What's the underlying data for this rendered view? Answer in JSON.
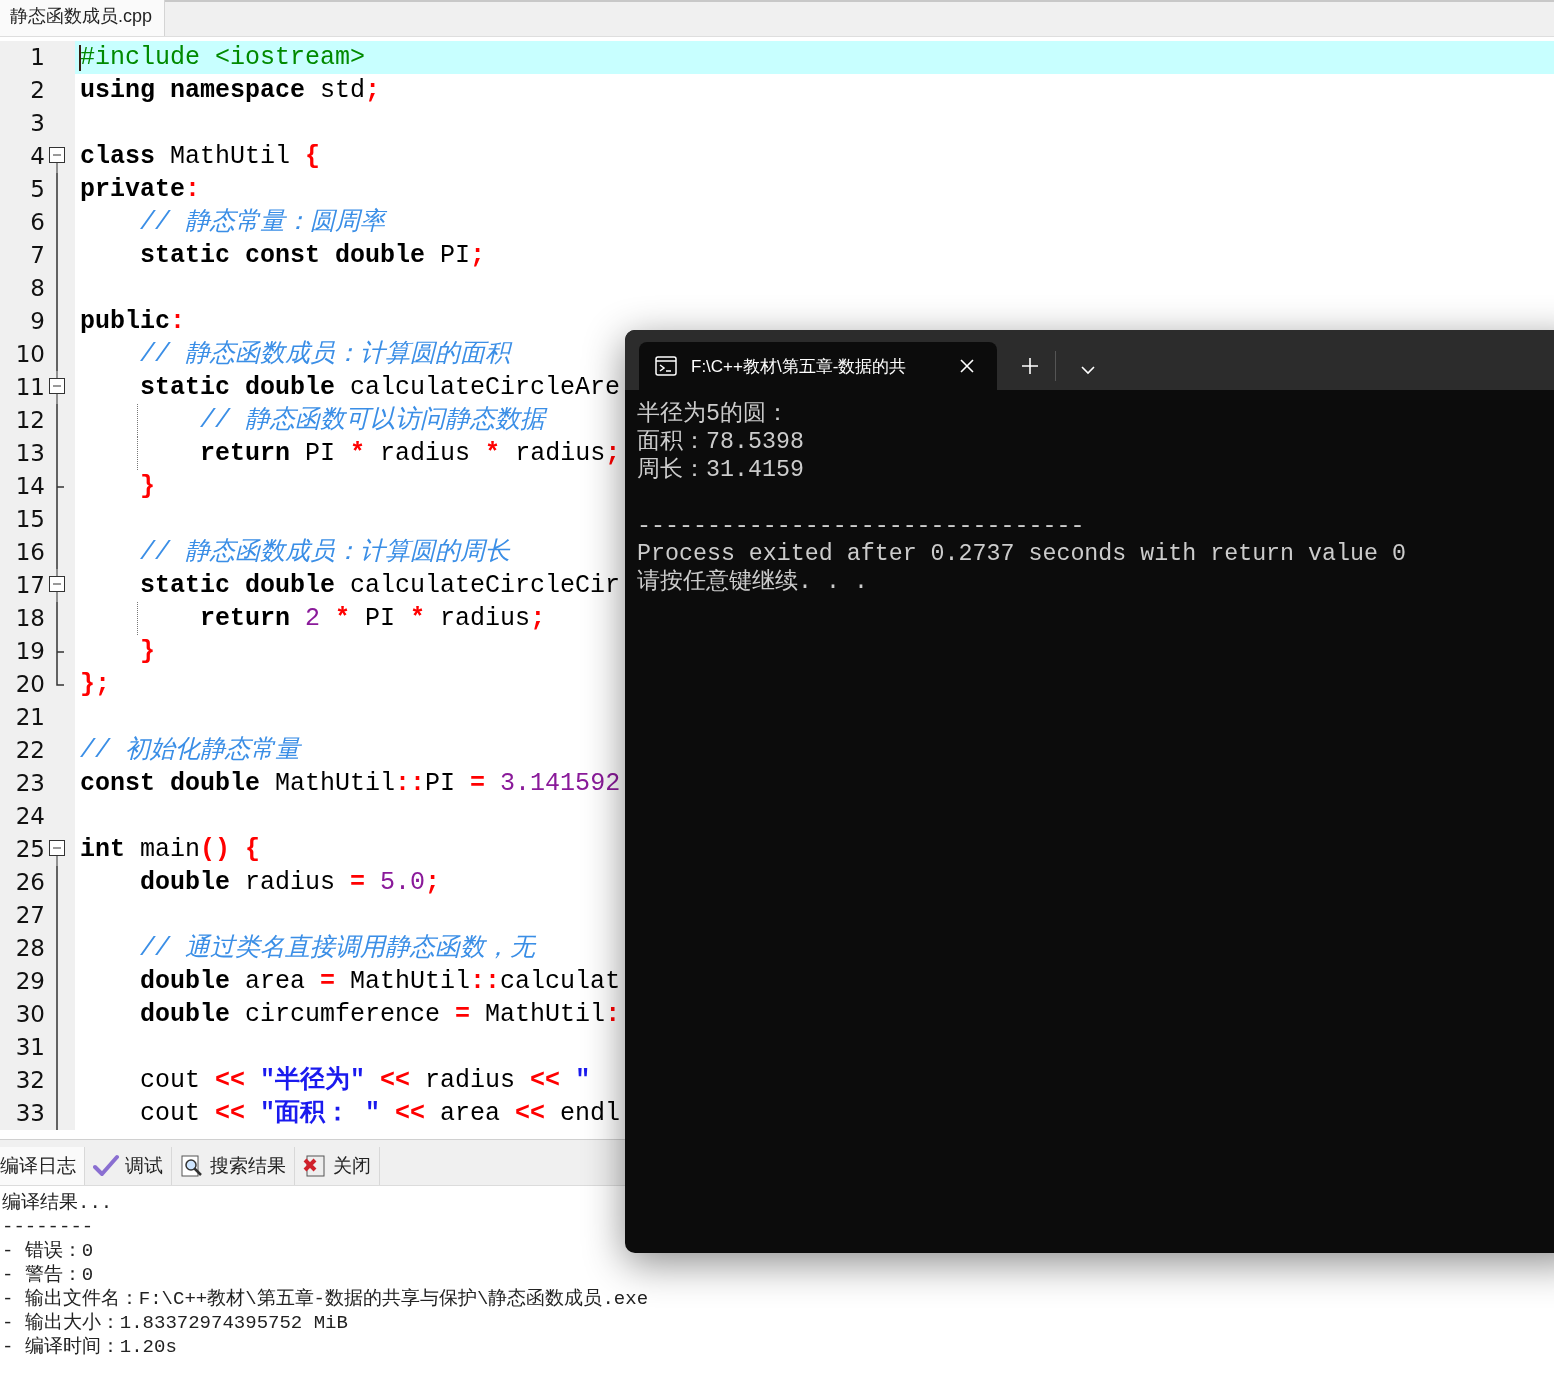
{
  "file_tab": {
    "title": "静态函数成员.cpp",
    "selected": true
  },
  "lines": [
    {
      "number": "1",
      "current": true,
      "kind": "plain",
      "guide": false,
      "tokens": [
        {
          "kind": "directive",
          "text": "#include <iostream>"
        }
      ]
    },
    {
      "number": "2",
      "current": false,
      "kind": "plain",
      "guide": false,
      "tokens": [
        {
          "kind": "keyword",
          "text": "using namespace"
        },
        {
          "kind": "plain",
          "text": " std"
        },
        {
          "kind": "punct",
          "text": ";"
        }
      ]
    },
    {
      "number": "3",
      "current": false,
      "kind": "plain",
      "guide": false
    },
    {
      "number": "4",
      "current": false,
      "kind": "fold-start",
      "guide": false,
      "tokens": [
        {
          "kind": "keyword",
          "text": "class"
        },
        {
          "kind": "plain",
          "text": " MathUtil "
        },
        {
          "kind": "punct",
          "text": "{"
        }
      ]
    },
    {
      "number": "5",
      "current": false,
      "kind": "fold-bar",
      "guide": false,
      "tokens": [
        {
          "kind": "keyword",
          "text": "private"
        },
        {
          "kind": "punct",
          "text": ":"
        }
      ]
    },
    {
      "number": "6",
      "current": false,
      "kind": "fold-bar",
      "guide": false,
      "tokens": [
        {
          "kind": "comment",
          "text": "    // 静态常量：圆周率"
        }
      ]
    },
    {
      "number": "7",
      "current": false,
      "kind": "fold-bar",
      "guide": false,
      "tokens": [
        {
          "kind": "keyword",
          "text": "    static const double"
        },
        {
          "kind": "plain",
          "text": " PI"
        },
        {
          "kind": "punct",
          "text": ";"
        }
      ]
    },
    {
      "number": "8",
      "current": false,
      "kind": "fold-bar",
      "guide": false
    },
    {
      "number": "9",
      "current": false,
      "kind": "fold-bar",
      "guide": false,
      "tokens": [
        {
          "kind": "keyword",
          "text": "public"
        },
        {
          "kind": "punct",
          "text": ":"
        }
      ]
    },
    {
      "number": "10",
      "current": false,
      "kind": "fold-bar",
      "guide": false,
      "tokens": [
        {
          "kind": "comment",
          "text": "    // 静态函数成员：计算圆的面积"
        }
      ]
    },
    {
      "number": "11",
      "current": false,
      "kind": "fold-inner-start",
      "guide": false,
      "tokens": [
        {
          "kind": "keyword",
          "text": "    static double"
        },
        {
          "kind": "plain",
          "text": " calculateCircleAre"
        }
      ]
    },
    {
      "number": "12",
      "current": false,
      "kind": "fold-bar",
      "guide": true,
      "tokens": [
        {
          "kind": "comment",
          "text": "        // 静态函数可以访问静态数据"
        }
      ]
    },
    {
      "number": "13",
      "current": false,
      "kind": "fold-bar",
      "guide": true,
      "tokens": [
        {
          "kind": "keyword",
          "text": "        return"
        },
        {
          "kind": "plain",
          "text": " PI "
        },
        {
          "kind": "punct",
          "text": "*"
        },
        {
          "kind": "plain",
          "text": " radius "
        },
        {
          "kind": "punct",
          "text": "*"
        },
        {
          "kind": "plain",
          "text": " radius"
        },
        {
          "kind": "punct",
          "text": ";"
        }
      ]
    },
    {
      "number": "14",
      "current": false,
      "kind": "fold-inner-end",
      "guide": false,
      "tokens": [
        {
          "kind": "punct",
          "text": "    }"
        }
      ]
    },
    {
      "number": "15",
      "current": false,
      "kind": "fold-bar",
      "guide": false
    },
    {
      "number": "16",
      "current": false,
      "kind": "fold-bar",
      "guide": false,
      "tokens": [
        {
          "kind": "comment",
          "text": "    // 静态函数成员：计算圆的周长"
        }
      ]
    },
    {
      "number": "17",
      "current": false,
      "kind": "fold-inner-start",
      "guide": false,
      "tokens": [
        {
          "kind": "keyword",
          "text": "    static double"
        },
        {
          "kind": "plain",
          "text": " calculateCircleCir"
        }
      ]
    },
    {
      "number": "18",
      "current": false,
      "kind": "fold-bar",
      "guide": true,
      "tokens": [
        {
          "kind": "keyword",
          "text": "        return"
        },
        {
          "kind": "number",
          "text": " 2 "
        },
        {
          "kind": "punct",
          "text": "*"
        },
        {
          "kind": "plain",
          "text": " PI "
        },
        {
          "kind": "punct",
          "text": "*"
        },
        {
          "kind": "plain",
          "text": " radius"
        },
        {
          "kind": "punct",
          "text": ";"
        }
      ]
    },
    {
      "number": "19",
      "current": false,
      "kind": "fold-inner-end",
      "guide": false,
      "tokens": [
        {
          "kind": "punct",
          "text": "    }"
        }
      ]
    },
    {
      "number": "20",
      "current": false,
      "kind": "fold-end",
      "guide": false,
      "tokens": [
        {
          "kind": "punct",
          "text": "};"
        }
      ]
    },
    {
      "number": "21",
      "current": false,
      "kind": "plain",
      "guide": false
    },
    {
      "number": "22",
      "current": false,
      "kind": "plain",
      "guide": false,
      "tokens": [
        {
          "kind": "comment",
          "text": "// 初始化静态常量"
        }
      ]
    },
    {
      "number": "23",
      "current": false,
      "kind": "plain",
      "guide": false,
      "tokens": [
        {
          "kind": "keyword",
          "text": "const double"
        },
        {
          "kind": "plain",
          "text": " MathUtil"
        },
        {
          "kind": "punct",
          "text": "::"
        },
        {
          "kind": "plain",
          "text": "PI "
        },
        {
          "kind": "punct",
          "text": "="
        },
        {
          "kind": "number",
          "text": " 3.141592"
        }
      ]
    },
    {
      "number": "24",
      "current": false,
      "kind": "plain",
      "guide": false
    },
    {
      "number": "25",
      "current": false,
      "kind": "fold-start",
      "guide": false,
      "tokens": [
        {
          "kind": "keyword",
          "text": "int"
        },
        {
          "kind": "plain",
          "text": " main"
        },
        {
          "kind": "punct",
          "text": "() {"
        }
      ]
    },
    {
      "number": "26",
      "current": false,
      "kind": "fold-bar",
      "guide": false,
      "tokens": [
        {
          "kind": "keyword",
          "text": "    double"
        },
        {
          "kind": "plain",
          "text": " radius "
        },
        {
          "kind": "punct",
          "text": "="
        },
        {
          "kind": "number",
          "text": " 5.0"
        },
        {
          "kind": "punct",
          "text": ";"
        }
      ]
    },
    {
      "number": "27",
      "current": false,
      "kind": "fold-bar",
      "guide": false
    },
    {
      "number": "28",
      "current": false,
      "kind": "fold-bar",
      "guide": false,
      "tokens": [
        {
          "kind": "comment",
          "text": "    // 通过类名直接调用静态函数，无"
        }
      ]
    },
    {
      "number": "29",
      "current": false,
      "kind": "fold-bar",
      "guide": false,
      "tokens": [
        {
          "kind": "keyword",
          "text": "    double"
        },
        {
          "kind": "plain",
          "text": " area "
        },
        {
          "kind": "punct",
          "text": "="
        },
        {
          "kind": "plain",
          "text": " MathUtil"
        },
        {
          "kind": "punct",
          "text": "::"
        },
        {
          "kind": "plain",
          "text": "calculat"
        }
      ]
    },
    {
      "number": "30",
      "current": false,
      "kind": "fold-bar",
      "guide": false,
      "tokens": [
        {
          "kind": "keyword",
          "text": "    double"
        },
        {
          "kind": "plain",
          "text": " circumference "
        },
        {
          "kind": "punct",
          "text": "="
        },
        {
          "kind": "plain",
          "text": " MathUtil"
        },
        {
          "kind": "punct",
          "text": ":"
        }
      ]
    },
    {
      "number": "31",
      "current": false,
      "kind": "fold-bar",
      "guide": false
    },
    {
      "number": "32",
      "current": false,
      "kind": "fold-bar",
      "guide": false,
      "tokens": [
        {
          "kind": "plain",
          "text": "    cout "
        },
        {
          "kind": "punct",
          "text": "<<"
        },
        {
          "kind": "string",
          "text": " \"半径为\" "
        },
        {
          "kind": "punct",
          "text": "<<"
        },
        {
          "kind": "plain",
          "text": " radius "
        },
        {
          "kind": "punct",
          "text": "<<"
        },
        {
          "kind": "string",
          "text": " \""
        }
      ]
    },
    {
      "number": "33",
      "current": false,
      "kind": "fold-bar",
      "guide": false,
      "tokens": [
        {
          "kind": "plain",
          "text": "    cout "
        },
        {
          "kind": "punct",
          "text": "<<"
        },
        {
          "kind": "string",
          "text": " \"面积： \" "
        },
        {
          "kind": "punct",
          "text": "<<"
        },
        {
          "kind": "plain",
          "text": " area "
        },
        {
          "kind": "punct",
          "text": "<<"
        },
        {
          "kind": "plain",
          "text": " endl"
        }
      ]
    }
  ],
  "panel_tabs": [
    {
      "label": "编译日志",
      "kind": "plain",
      "selected": true
    },
    {
      "label": "调试",
      "kind": "check",
      "selected": false
    },
    {
      "label": "搜索结果",
      "kind": "search",
      "selected": false
    },
    {
      "label": "关闭",
      "kind": "close",
      "selected": false
    }
  ],
  "log": [
    "编译结果...",
    "--------",
    "- 错误：0",
    "- 警告：0",
    "- 输出文件名：F:\\C++教材\\第五章-数据的共享与保护\\静态函数成员.exe",
    "- 输出大小：1.83372974395752 MiB",
    "- 编译时间：1.20s"
  ],
  "terminal": {
    "tabs": [
      {
        "title": "F:\\C++教材\\第五章-数据的共",
        "selected": true
      }
    ],
    "output": [
      "半径为5的圆：",
      "面积：78.5398",
      "周长：31.4159"
    ],
    "separator": "--------------------------------",
    "exit_message": "Process exited after 0.2737 seconds with return value 0",
    "prompt": "请按任意键继续. . ."
  }
}
